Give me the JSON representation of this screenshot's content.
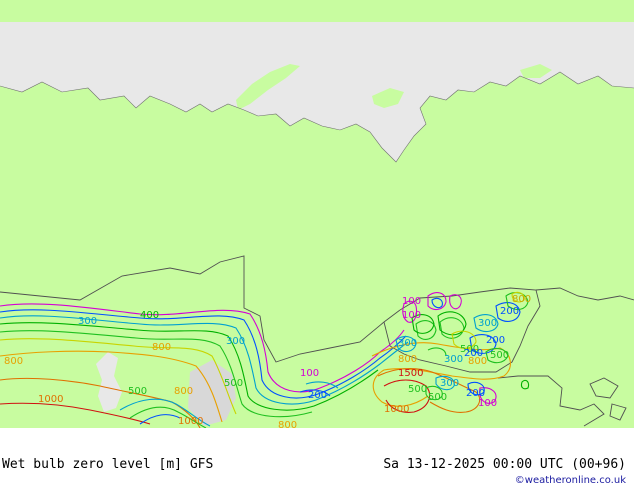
{
  "footer": {
    "title": "Wet bulb zero level [m] GFS",
    "datetime": "Sa 13-12-2025 00:00 UTC (00+96)",
    "credit": "©weatheronline.co.uk"
  },
  "colors": {
    "land": "#c8fca0",
    "sea": "#e8e8e8",
    "relief": "#d8d8d8",
    "border": "#505050",
    "coast": "#707070"
  },
  "contour_labels": [
    {
      "text": "100",
      "color": "#d400d4"
    },
    {
      "text": "100",
      "color": "#d400d4"
    },
    {
      "text": "100",
      "color": "#d400d4"
    },
    {
      "text": "100",
      "color": "#d400d4"
    },
    {
      "text": "200",
      "color": "#0050ff"
    },
    {
      "text": "200",
      "color": "#0050ff"
    },
    {
      "text": "200",
      "color": "#0050ff"
    },
    {
      "text": "200",
      "color": "#0050ff"
    },
    {
      "text": "300",
      "color": "#00a0d0"
    },
    {
      "text": "300",
      "color": "#00a0d0"
    },
    {
      "text": "300",
      "color": "#00a0d0"
    },
    {
      "text": "300",
      "color": "#00a0d0"
    },
    {
      "text": "300",
      "color": "#00a0d0"
    },
    {
      "text": "400",
      "color": "#00b000"
    },
    {
      "text": "500",
      "color": "#20c020"
    },
    {
      "text": "500",
      "color": "#20c020"
    },
    {
      "text": "500",
      "color": "#20c020"
    },
    {
      "text": "500",
      "color": "#20c020"
    },
    {
      "text": "500",
      "color": "#20c020"
    },
    {
      "text": "500",
      "color": "#20c020"
    },
    {
      "text": "800",
      "color": "#c8a800"
    },
    {
      "text": "800",
      "color": "#e8a000"
    },
    {
      "text": "800",
      "color": "#e8a000"
    },
    {
      "text": "800",
      "color": "#e8a000"
    },
    {
      "text": "800",
      "color": "#e8a000"
    },
    {
      "text": "800",
      "color": "#e8a000"
    },
    {
      "text": "800",
      "color": "#e8a000"
    },
    {
      "text": "1000",
      "color": "#e07000"
    },
    {
      "text": "1000",
      "color": "#e07000"
    },
    {
      "text": "1000",
      "color": "#e07000"
    },
    {
      "text": "1500",
      "color": "#d01010"
    },
    {
      "text": "300",
      "color": "#00a0d0"
    },
    {
      "text": "200",
      "color": "#0050ff"
    }
  ]
}
